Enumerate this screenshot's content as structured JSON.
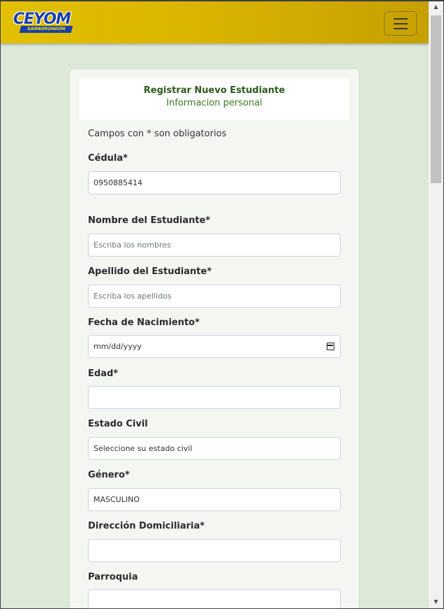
{
  "brand": {
    "name": "CEYOM",
    "subtitle": "SAMBORONDÓN"
  },
  "colors": {
    "navbar": "#d9b500",
    "page_bg": "#dde8d8",
    "title_green": "#2c5a1c",
    "logo_blue": "#1a3fa8"
  },
  "form": {
    "title": "Registrar Nuevo Estudiante",
    "subtitle": "Informacion personal",
    "note": "Campos con * son obligatorios",
    "fields": {
      "cedula": {
        "label": "Cédula*",
        "value": "0950885414"
      },
      "nombre": {
        "label": "Nombre del Estudiante*",
        "placeholder": "Escriba los nombres"
      },
      "apellido": {
        "label": "Apellido del Estudiante*",
        "placeholder": "Escriba los apellidos"
      },
      "fecha": {
        "label": "Fecha de Nacimiento*",
        "placeholder": "mm/dd/yyyy",
        "icon": "calendar-icon"
      },
      "edad": {
        "label": "Edad*",
        "value": ""
      },
      "estado_civil": {
        "label": "Estado Civil",
        "value": "Seleccione su estado civil"
      },
      "genero": {
        "label": "Género*",
        "value": "MASCULINO"
      },
      "direccion": {
        "label": "Dirección Domiciliaria*",
        "value": ""
      },
      "parroquia": {
        "label": "Parroquia",
        "value": ""
      }
    }
  },
  "icons": {
    "menu": "hamburger-menu-icon",
    "scroll_up": "scroll-up-arrow-icon",
    "scroll_down": "scroll-down-arrow-icon"
  }
}
